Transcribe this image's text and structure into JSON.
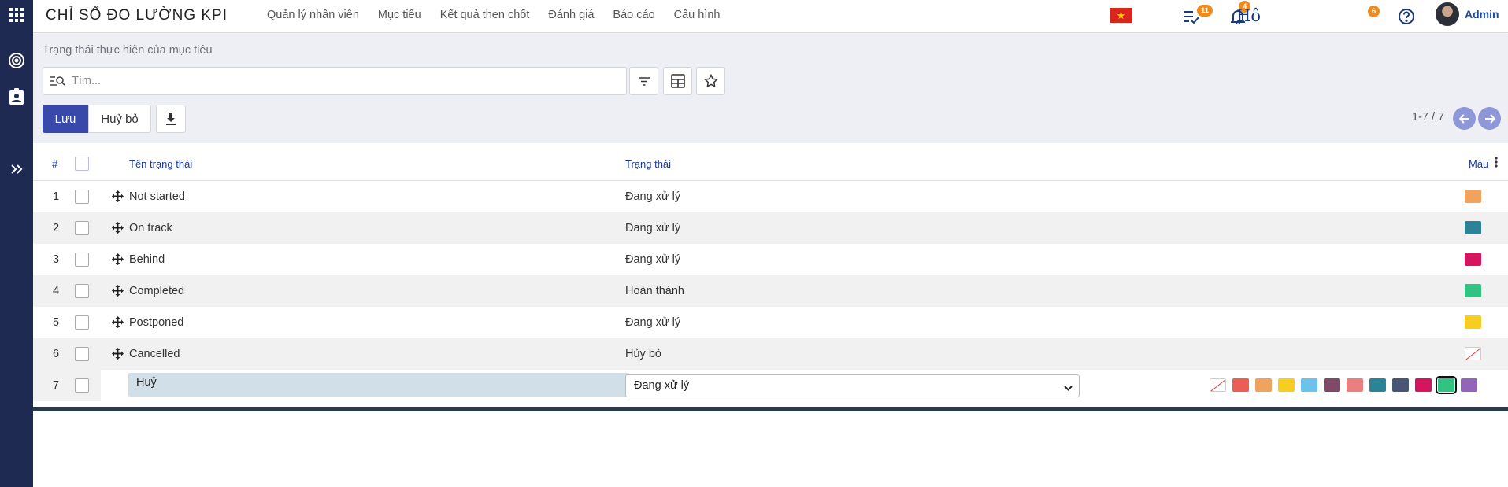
{
  "app": {
    "title": "CHỈ SỐ ĐO LƯỜNG KPI"
  },
  "menu": [
    {
      "label": "Quản lý nhân viên"
    },
    {
      "label": "Mục tiêu"
    },
    {
      "label": "Kết quả then chốt"
    },
    {
      "label": "Đánh giá"
    },
    {
      "label": "Báo cáo"
    },
    {
      "label": "Cấu hình"
    }
  ],
  "topbar": {
    "activity_badge": "11",
    "notification_badge": "4",
    "ho_text": "Hô",
    "chat_badge": "6",
    "user_name": "Admin",
    "flag_icon": "vietnam-flag-icon"
  },
  "breadcrumb": "Trạng thái thực hiện của mục tiêu",
  "search": {
    "placeholder": "Tìm..."
  },
  "actions": {
    "save_label": "Lưu",
    "cancel_label": "Huỷ bỏ"
  },
  "pager": {
    "text": "1-7 / 7"
  },
  "table": {
    "headers": {
      "index": "#",
      "name": "Tên trạng thái",
      "status": "Trạng thái",
      "color": "Màu"
    },
    "rows": [
      {
        "index": "1",
        "name": "Not started",
        "status": "Đang xử lý",
        "color": "#f0a35e"
      },
      {
        "index": "2",
        "name": "On track",
        "status": "Đang xử lý",
        "color": "#2c8397"
      },
      {
        "index": "3",
        "name": "Behind",
        "status": "Đang xử lý",
        "color": "#d6145f"
      },
      {
        "index": "4",
        "name": "Completed",
        "status": "Hoàn thành",
        "color": "#30c381"
      },
      {
        "index": "5",
        "name": "Postponed",
        "status": "Đang xử lý",
        "color": "#f7cd1f"
      },
      {
        "index": "6",
        "name": "Cancelled",
        "status": "Hủy bỏ",
        "color": "none"
      }
    ],
    "edit_row": {
      "index": "7",
      "name": "Huỷ",
      "status": "Đang xử lý"
    }
  },
  "palette": [
    "none",
    "#ee5d55",
    "#f0a35e",
    "#f7cd1f",
    "#6cc1ed",
    "#814968",
    "#eb7e7f",
    "#2c8397",
    "#475577",
    "#d6145f",
    "#30c381",
    "#9365b8"
  ],
  "palette_selected": "#30c381"
}
